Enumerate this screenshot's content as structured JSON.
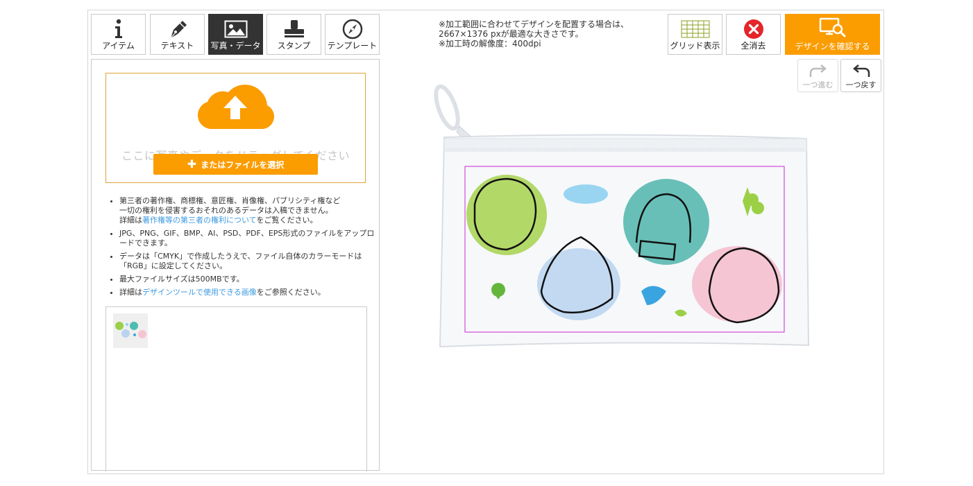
{
  "toolbar": {
    "tools": [
      {
        "label": "アイテム",
        "icon": "info-icon"
      },
      {
        "label": "テキスト",
        "icon": "pen-icon"
      },
      {
        "label": "写真・データ",
        "icon": "image-icon",
        "active": true
      },
      {
        "label": "スタンプ",
        "icon": "stamp-icon"
      },
      {
        "label": "テンプレート",
        "icon": "template-icon"
      }
    ],
    "grid_label": "グリッド表示",
    "clear_label": "全消去",
    "confirm_label": "デザインを確認する",
    "redo_label": "一つ進む",
    "undo_label": "一つ戻す"
  },
  "notes": {
    "line1": "※加工範囲に合わせてデザインを配置する場合は、",
    "line2": "2667×1376 pxが最適な大きさです。",
    "line3": "※加工時の解像度：400dpi"
  },
  "upload": {
    "drop_hint": "ここに写真やデータをドラッグしてください",
    "file_button": "またはファイルを選択"
  },
  "rules": {
    "item1_line1": "第三者の著作権、商標権、意匠権、肖像権、パブリシティ権など",
    "item1_line2": "一切の権利を侵害するおそれのあるデータは入稿できません。",
    "item1_prefix": "詳細は",
    "item1_link": "著作権等の第三者の権利について",
    "item1_suffix": "をご覧ください。",
    "item2": "JPG、PNG、GIF、BMP、AI、PSD、PDF、EPS形式のファイルをアップロードできます。",
    "item3": "データは「CMYK」で作成したうえで、ファイル自体のカラーモードは「RGB」に設定してください。",
    "item4": "最大ファイルサイズは500MBです。",
    "item5_prefix": "詳細は",
    "item5_link": "デザインツールで使用できる画像",
    "item5_suffix": "をご参照ください。"
  },
  "colors": {
    "accent": "#fb9c00",
    "active_tab": "#333333",
    "link": "#3d9ae0",
    "print_area": "#d24bd8",
    "clear_red": "#e5242b",
    "grid_green": "#8aa022"
  }
}
